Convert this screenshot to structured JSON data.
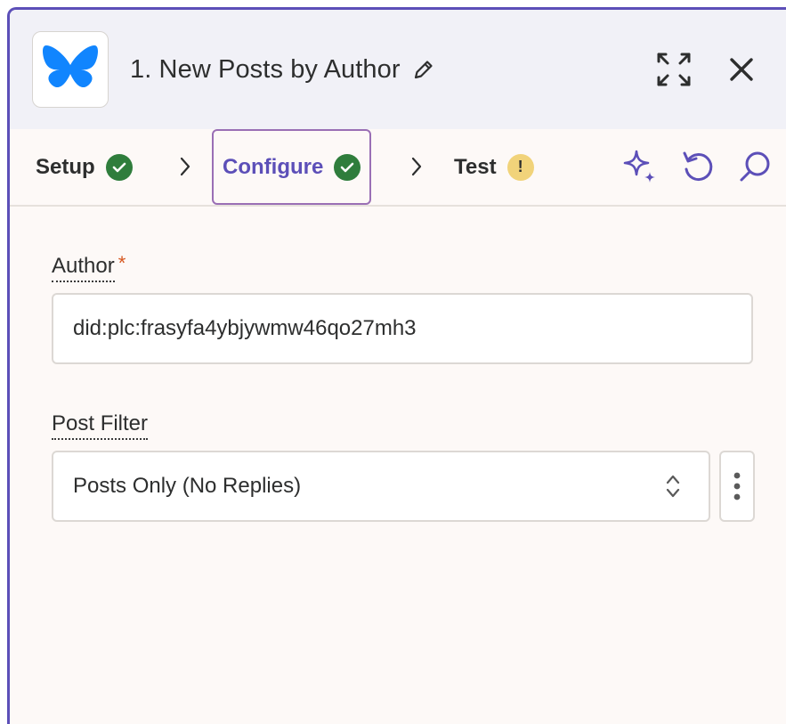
{
  "header": {
    "app_icon": "butterfly-icon",
    "title": "1. New Posts by Author",
    "edit_icon": "pencil-icon",
    "expand_icon": "expand-icon",
    "close_icon": "close-icon"
  },
  "steps": [
    {
      "label": "Setup",
      "status": "complete"
    },
    {
      "label": "Configure",
      "status": "complete",
      "active": true
    },
    {
      "label": "Test",
      "status": "warning",
      "badge": "!"
    }
  ],
  "tools": [
    "sparkle-icon",
    "undo-icon",
    "search-icon"
  ],
  "fields": {
    "author": {
      "label": "Author",
      "required_mark": "*",
      "value": "did:plc:frasyfa4ybjywmw46qo27mh3"
    },
    "post_filter": {
      "label": "Post Filter",
      "selected": "Posts Only (No Replies)"
    }
  },
  "colors": {
    "accent": "#5c4fb8",
    "success": "#2f7d3c",
    "warning": "#f1d37a",
    "required": "#d6571f",
    "brand_blue": "#1185fe"
  }
}
